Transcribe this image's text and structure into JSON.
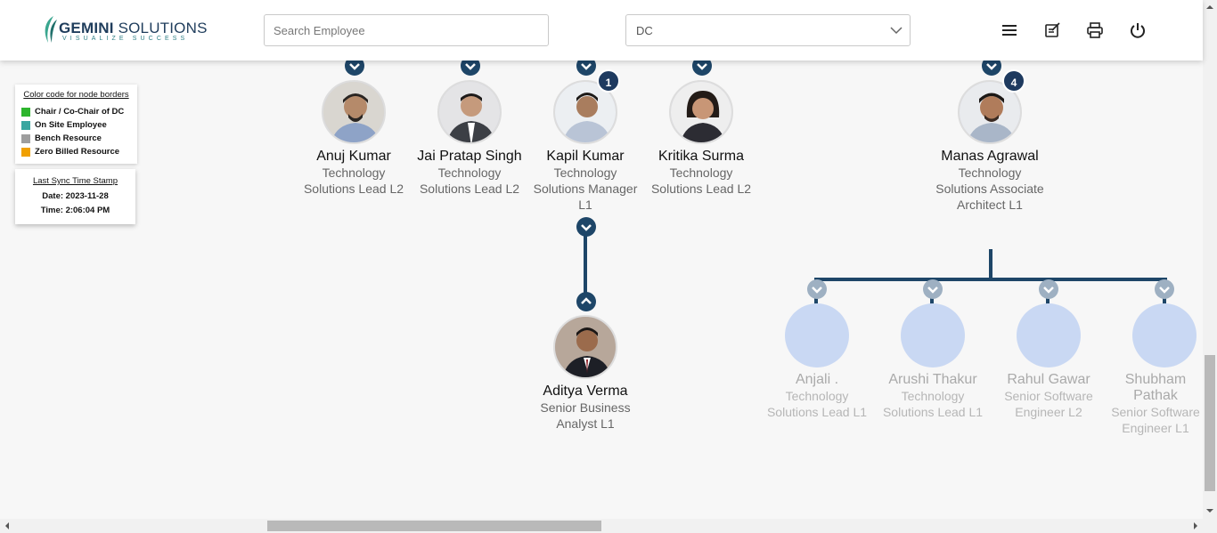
{
  "header": {
    "logo_text_bold": "GEMINI",
    "logo_text_rest": " SOLUTIONS",
    "logo_tagline": "VISUALIZE SUCCESS",
    "search_placeholder": "Search Employee",
    "dept_select_value": "DC",
    "icons": [
      "menu-icon",
      "edit-notes-icon",
      "print-icon",
      "power-icon"
    ]
  },
  "legend": {
    "title": "Color code for node borders",
    "items": [
      {
        "label": "Chair / Co-Chair of DC",
        "color": "#2db52d"
      },
      {
        "label": "On Site Employee",
        "color": "#3aa6a0"
      },
      {
        "label": "Bench Resource",
        "color": "#9e9e9e"
      },
      {
        "label": "Zero Billed Resource",
        "color": "#f0a000"
      }
    ]
  },
  "sync": {
    "title": "Last Sync Time Stamp",
    "date": "Date: 2023-11-28",
    "time": "Time: 2:06:04 PM"
  },
  "nodes": [
    {
      "name": "Anuj Kumar",
      "title": "Technology Solutions Lead L2"
    },
    {
      "name": "Jai Pratap Singh",
      "title": "Technology Solutions Lead L2"
    },
    {
      "name": "Kapil Kumar",
      "title": "Technology Solutions Manager L1",
      "count": "1"
    },
    {
      "name": "Kritika Surma",
      "title": "Technology Solutions Lead L2"
    },
    {
      "name": "Manas Agrawal",
      "title": "Technology Solutions Associate Architect L1",
      "count": "4"
    },
    {
      "name": "Aditya Verma",
      "title": "Senior Business Analyst L1"
    },
    {
      "name": "Anjali .",
      "title": "Technology Solutions Lead L1"
    },
    {
      "name": "Arushi Thakur",
      "title": "Technology Solutions Lead L1"
    },
    {
      "name": "Rahul Gawar",
      "title": "Senior Software Engineer L2"
    },
    {
      "name": "Shubham Pathak",
      "title": "Senior Software Engineer L1"
    }
  ],
  "colors": {
    "accent": "#1e4668",
    "badge": "#1e3a5f",
    "faded_avatar": "#c9d8f3"
  }
}
